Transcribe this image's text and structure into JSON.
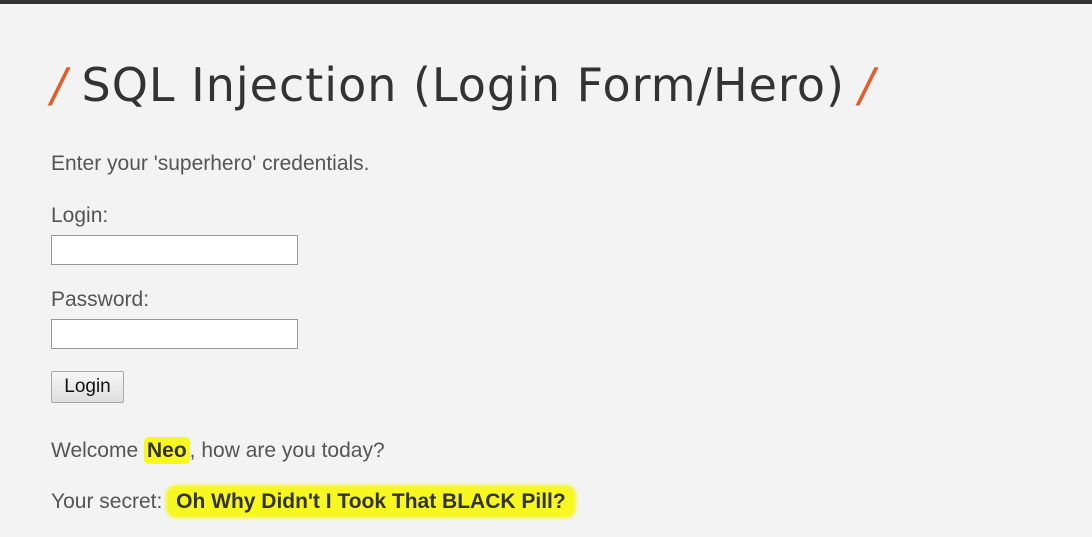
{
  "page": {
    "title": "SQL Injection (Login Form/Hero)",
    "title_slash": "/",
    "accent_color": "#e55b2a",
    "highlight_color": "#f7f721"
  },
  "form": {
    "intro": "Enter your 'superhero' credentials.",
    "login_label": "Login:",
    "login_value": "",
    "password_label": "Password:",
    "password_value": "",
    "submit_label": "Login"
  },
  "result": {
    "welcome_prefix": "Welcome ",
    "user_name": "Neo",
    "welcome_suffix": ", how are you today?",
    "secret_prefix": "Your secret: ",
    "secret_value": "Oh Why Didn't I Took That BLACK Pill?"
  }
}
